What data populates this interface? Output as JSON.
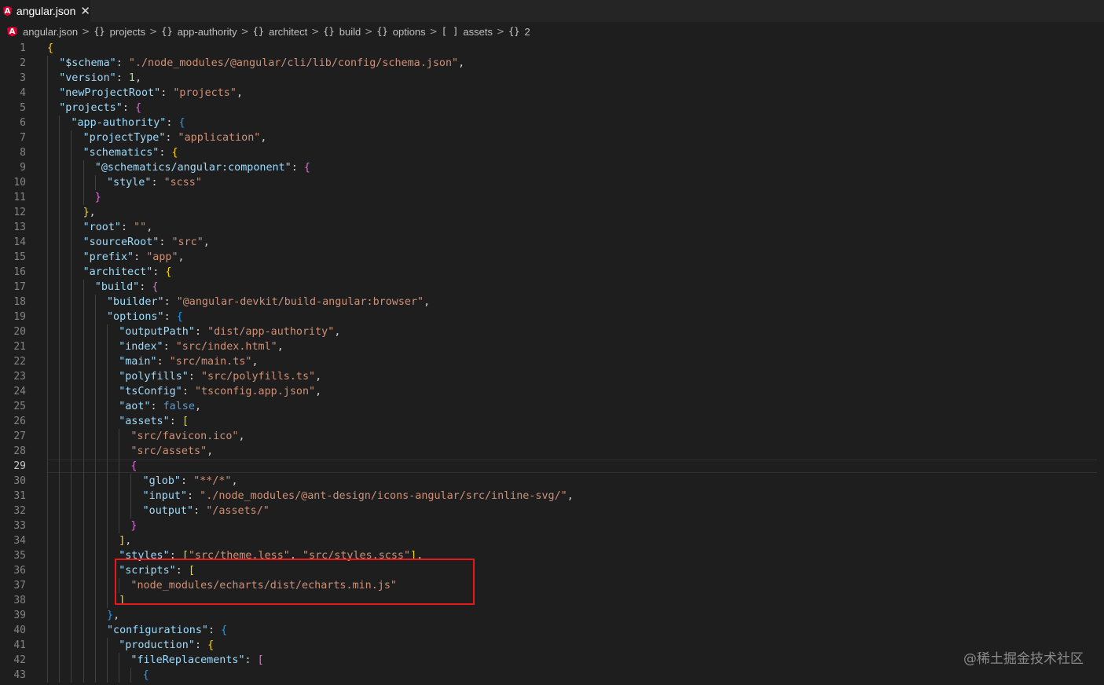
{
  "tab": {
    "title": "angular.json",
    "icon": "angular-icon",
    "close_glyph": "✕"
  },
  "breadcrumb": [
    {
      "sym": "",
      "label": "angular.json",
      "icon": "angular-icon"
    },
    {
      "sym": "{}",
      "label": "projects"
    },
    {
      "sym": "{}",
      "label": "app-authority"
    },
    {
      "sym": "{}",
      "label": "architect"
    },
    {
      "sym": "{}",
      "label": "build"
    },
    {
      "sym": "{}",
      "label": "options"
    },
    {
      "sym": "[ ]",
      "label": "assets"
    },
    {
      "sym": "{}",
      "label": "2"
    }
  ],
  "editor": {
    "active_line": 29,
    "lines": [
      [
        [
          "y",
          "{"
        ]
      ],
      [
        [
          "k",
          "\"$schema\""
        ],
        [
          "p",
          ": "
        ],
        [
          "s",
          "\"./node_modules/@angular/cli/lib/config/schema.json\""
        ],
        [
          "p",
          ","
        ]
      ],
      [
        [
          "k",
          "\"version\""
        ],
        [
          "p",
          ": "
        ],
        [
          "n",
          "1"
        ],
        [
          "p",
          ","
        ]
      ],
      [
        [
          "k",
          "\"newProjectRoot\""
        ],
        [
          "p",
          ": "
        ],
        [
          "s",
          "\"projects\""
        ],
        [
          "p",
          ","
        ]
      ],
      [
        [
          "k",
          "\"projects\""
        ],
        [
          "p",
          ": "
        ],
        [
          "m",
          "{"
        ]
      ],
      [
        [
          "k",
          "\"app-authority\""
        ],
        [
          "p",
          ": "
        ],
        [
          "c",
          "{"
        ]
      ],
      [
        [
          "k",
          "\"projectType\""
        ],
        [
          "p",
          ": "
        ],
        [
          "s",
          "\"application\""
        ],
        [
          "p",
          ","
        ]
      ],
      [
        [
          "k",
          "\"schematics\""
        ],
        [
          "p",
          ": "
        ],
        [
          "y",
          "{"
        ]
      ],
      [
        [
          "k",
          "\"@schematics/angular:component\""
        ],
        [
          "p",
          ": "
        ],
        [
          "m",
          "{"
        ]
      ],
      [
        [
          "k",
          "\"style\""
        ],
        [
          "p",
          ": "
        ],
        [
          "s",
          "\"scss\""
        ]
      ],
      [
        [
          "m",
          "}"
        ]
      ],
      [
        [
          "y",
          "}"
        ],
        [
          "p",
          ","
        ]
      ],
      [
        [
          "k",
          "\"root\""
        ],
        [
          "p",
          ": "
        ],
        [
          "s",
          "\"\""
        ],
        [
          "p",
          ","
        ]
      ],
      [
        [
          "k",
          "\"sourceRoot\""
        ],
        [
          "p",
          ": "
        ],
        [
          "s",
          "\"src\""
        ],
        [
          "p",
          ","
        ]
      ],
      [
        [
          "k",
          "\"prefix\""
        ],
        [
          "p",
          ": "
        ],
        [
          "s",
          "\"app\""
        ],
        [
          "p",
          ","
        ]
      ],
      [
        [
          "k",
          "\"architect\""
        ],
        [
          "p",
          ": "
        ],
        [
          "y",
          "{"
        ]
      ],
      [
        [
          "k",
          "\"build\""
        ],
        [
          "p",
          ": "
        ],
        [
          "m",
          "{"
        ]
      ],
      [
        [
          "k",
          "\"builder\""
        ],
        [
          "p",
          ": "
        ],
        [
          "s",
          "\"@angular-devkit/build-angular:browser\""
        ],
        [
          "p",
          ","
        ]
      ],
      [
        [
          "k",
          "\"options\""
        ],
        [
          "p",
          ": "
        ],
        [
          "c",
          "{"
        ]
      ],
      [
        [
          "k",
          "\"outputPath\""
        ],
        [
          "p",
          ": "
        ],
        [
          "s",
          "\"dist/app-authority\""
        ],
        [
          "p",
          ","
        ]
      ],
      [
        [
          "k",
          "\"index\""
        ],
        [
          "p",
          ": "
        ],
        [
          "s",
          "\"src/index.html\""
        ],
        [
          "p",
          ","
        ]
      ],
      [
        [
          "k",
          "\"main\""
        ],
        [
          "p",
          ": "
        ],
        [
          "s",
          "\"src/main.ts\""
        ],
        [
          "p",
          ","
        ]
      ],
      [
        [
          "k",
          "\"polyfills\""
        ],
        [
          "p",
          ": "
        ],
        [
          "s",
          "\"src/polyfills.ts\""
        ],
        [
          "p",
          ","
        ]
      ],
      [
        [
          "k",
          "\"tsConfig\""
        ],
        [
          "p",
          ": "
        ],
        [
          "s",
          "\"tsconfig.app.json\""
        ],
        [
          "p",
          ","
        ]
      ],
      [
        [
          "k",
          "\"aot\""
        ],
        [
          "p",
          ": "
        ],
        [
          "b",
          "false"
        ],
        [
          "p",
          ","
        ]
      ],
      [
        [
          "k",
          "\"assets\""
        ],
        [
          "p",
          ": "
        ],
        [
          "y",
          "["
        ]
      ],
      [
        [
          "s",
          "\"src/favicon.ico\""
        ],
        [
          "p",
          ","
        ]
      ],
      [
        [
          "s",
          "\"src/assets\""
        ],
        [
          "p",
          ","
        ]
      ],
      [
        [
          "m",
          "{"
        ]
      ],
      [
        [
          "k",
          "\"glob\""
        ],
        [
          "p",
          ": "
        ],
        [
          "s",
          "\"**/*\""
        ],
        [
          "p",
          ","
        ]
      ],
      [
        [
          "k",
          "\"input\""
        ],
        [
          "p",
          ": "
        ],
        [
          "s",
          "\"./node_modules/@ant-design/icons-angular/src/inline-svg/\""
        ],
        [
          "p",
          ","
        ]
      ],
      [
        [
          "k",
          "\"output\""
        ],
        [
          "p",
          ": "
        ],
        [
          "s",
          "\"/assets/\""
        ]
      ],
      [
        [
          "m",
          "}"
        ]
      ],
      [
        [
          "y",
          "]"
        ],
        [
          "p",
          ","
        ]
      ],
      [
        [
          "k",
          "\"styles\""
        ],
        [
          "p",
          ": "
        ],
        [
          "y",
          "["
        ],
        [
          "s",
          "\"src/theme.less\""
        ],
        [
          "p",
          ", "
        ],
        [
          "s",
          "\"src/styles.scss\""
        ],
        [
          "y",
          "]"
        ],
        [
          "p",
          ","
        ]
      ],
      [
        [
          "k",
          "\"scripts\""
        ],
        [
          "p",
          ": "
        ],
        [
          "y",
          "["
        ]
      ],
      [
        [
          "s",
          "\"node_modules/echarts/dist/echarts.min.js\""
        ]
      ],
      [
        [
          "y",
          "]"
        ]
      ],
      [
        [
          "c",
          "}"
        ],
        [
          "p",
          ","
        ]
      ],
      [
        [
          "k",
          "\"configurations\""
        ],
        [
          "p",
          ": "
        ],
        [
          "c",
          "{"
        ]
      ],
      [
        [
          "k",
          "\"production\""
        ],
        [
          "p",
          ": "
        ],
        [
          "y",
          "{"
        ]
      ],
      [
        [
          "k",
          "\"fileReplacements\""
        ],
        [
          "p",
          ": "
        ],
        [
          "m",
          "["
        ]
      ],
      [
        [
          "c",
          "{"
        ]
      ]
    ]
  },
  "watermark": "@稀土掘金技术社区"
}
